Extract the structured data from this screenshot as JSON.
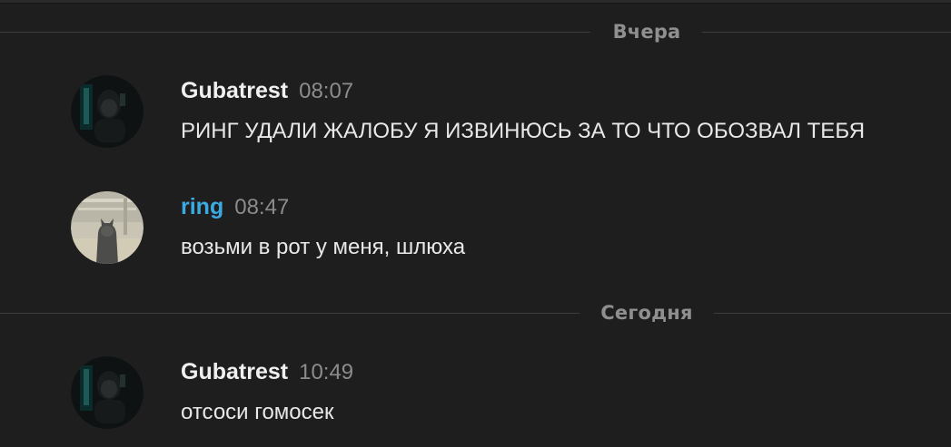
{
  "dividers": {
    "yesterday": "Вчера",
    "today": "Сегодня"
  },
  "messages": [
    {
      "author": "Gubatrest",
      "time": "08:07",
      "text": "РИНГ УДАЛИ ЖАЛОБУ Я ИЗВИНЮСЬ ЗА ТО ЧТО ОБОЗВАЛ ТЕБЯ",
      "author_color": "#f0f0f0",
      "avatar": "dark-figure-avatar"
    },
    {
      "author": "ring",
      "time": "08:47",
      "text": "возьми в рот у меня, шлюха",
      "author_color": "#3ca9e2",
      "avatar": "cat-avatar"
    },
    {
      "author": "Gubatrest",
      "time": "10:49",
      "text": "отсоси гомосек",
      "author_color": "#f0f0f0",
      "avatar": "dark-figure-avatar"
    }
  ]
}
